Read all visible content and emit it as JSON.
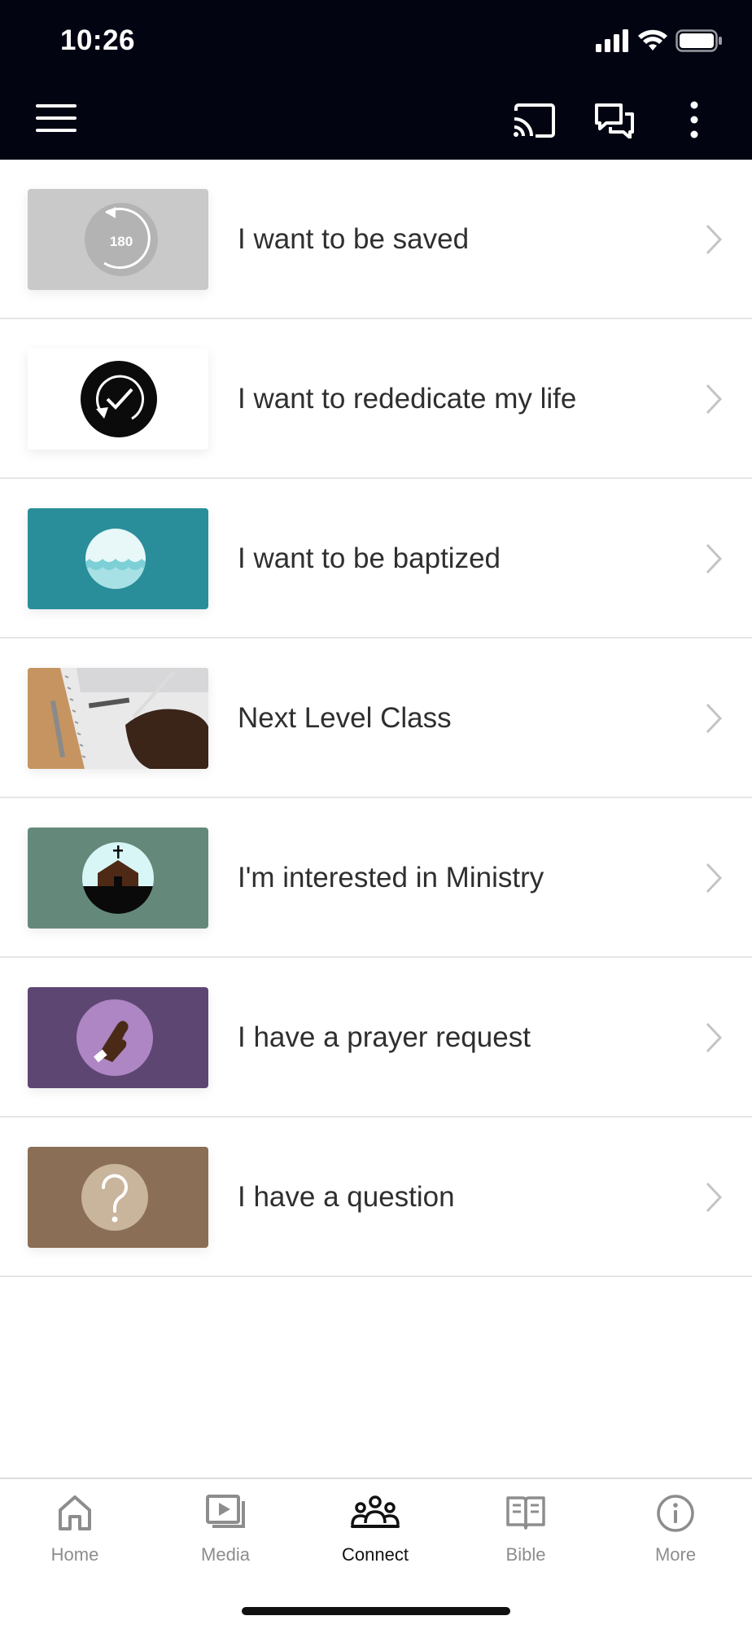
{
  "status_bar": {
    "time": "10:26"
  },
  "header": {
    "menu_icon": "hamburger-menu-icon",
    "cast_icon": "cast-icon",
    "chat_icon": "chat-bubbles-icon",
    "more_icon": "vertical-dots-icon"
  },
  "list": {
    "items": [
      {
        "label": "I want to be saved",
        "thumb_bg": "#c9c9c9",
        "icon": "180-turn-icon",
        "thumb_text": "180"
      },
      {
        "label": "I want to rededicate my life",
        "thumb_bg": "#ffffff",
        "icon": "circular-check-icon"
      },
      {
        "label": "I want to be baptized",
        "thumb_bg": "#2a8e9a",
        "icon": "water-circle-icon"
      },
      {
        "label": "Next Level Class",
        "thumb_bg": "#b98a57",
        "icon": "notebook-writing-photo"
      },
      {
        "label": "I'm interested in Ministry",
        "thumb_bg": "#64897a",
        "icon": "church-icon"
      },
      {
        "label": "I have a prayer request",
        "thumb_bg": "#5e4673",
        "icon": "praying-hands-icon"
      },
      {
        "label": "I have a question",
        "thumb_bg": "#8a6e55",
        "icon": "question-mark-icon"
      }
    ]
  },
  "tabbar": {
    "tabs": [
      {
        "label": "Home",
        "icon": "home-icon",
        "active": false
      },
      {
        "label": "Media",
        "icon": "media-play-icon",
        "active": false
      },
      {
        "label": "Connect",
        "icon": "people-group-icon",
        "active": true
      },
      {
        "label": "Bible",
        "icon": "open-book-icon",
        "active": false
      },
      {
        "label": "More",
        "icon": "info-circle-icon",
        "active": false
      }
    ]
  },
  "colors": {
    "header_bg": "#020412",
    "active_tab": "#111111",
    "inactive_tab": "#8d8d8d"
  }
}
